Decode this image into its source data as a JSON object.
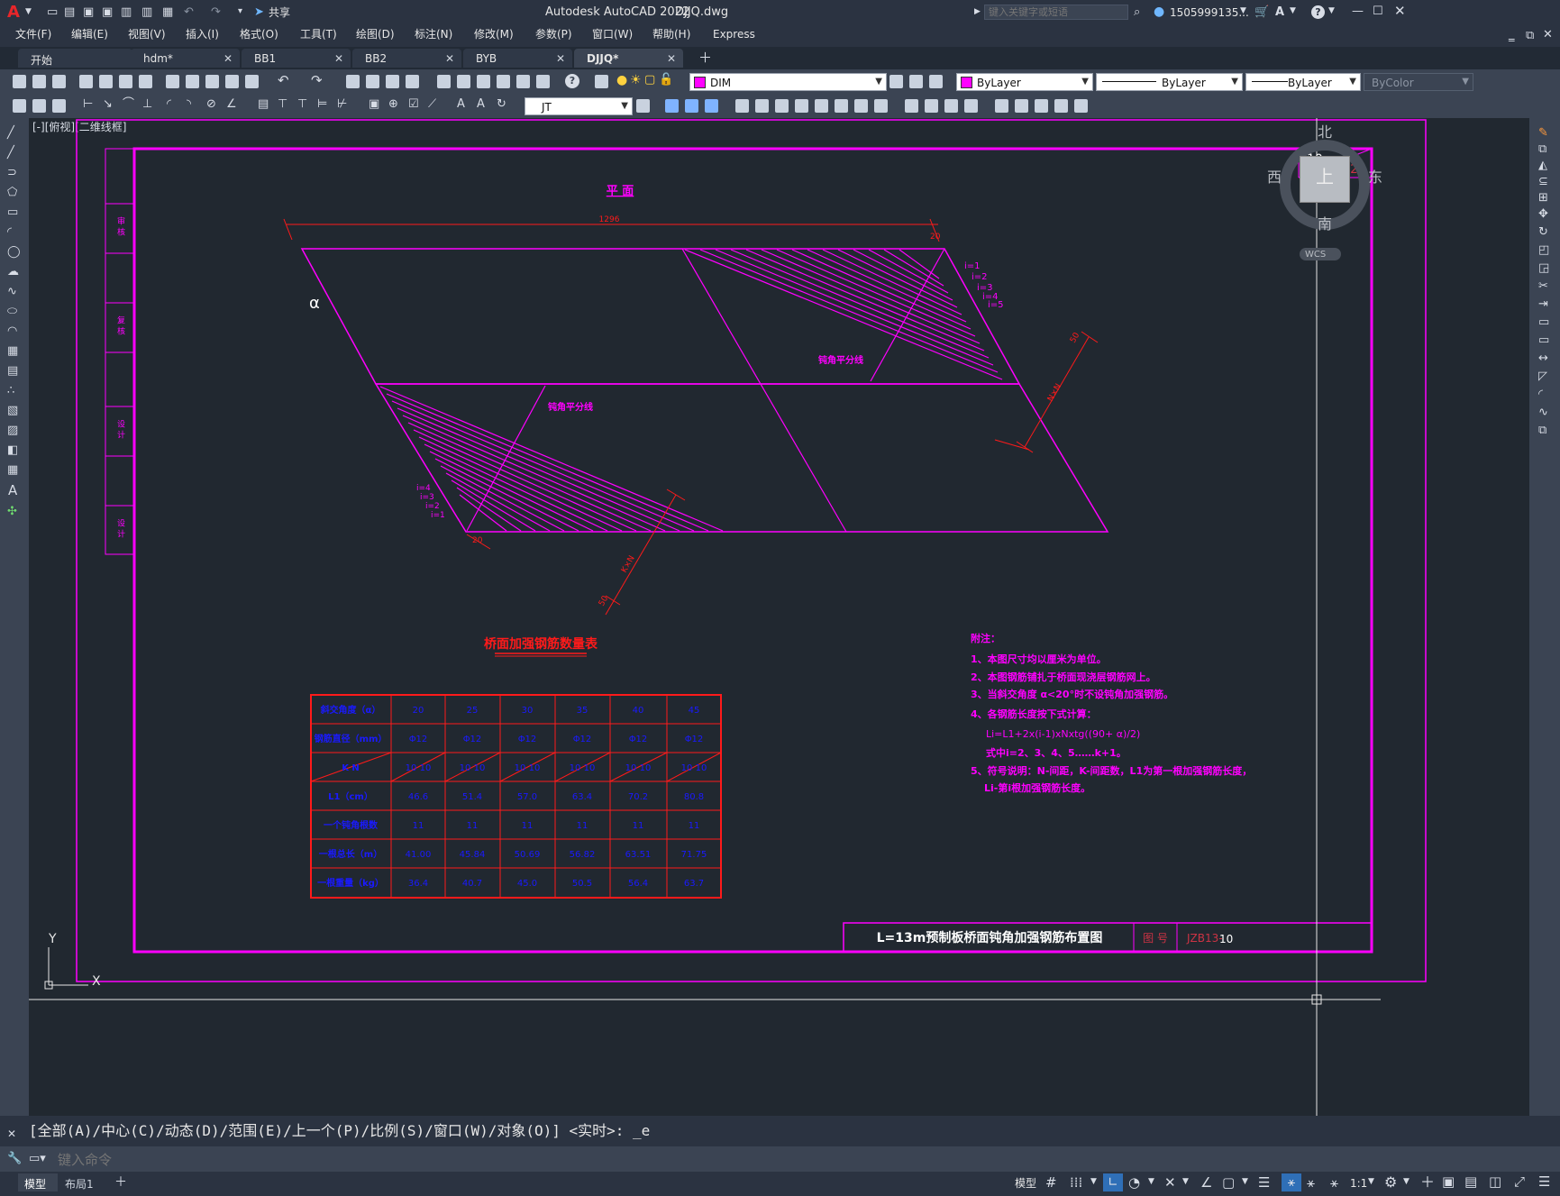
{
  "app": {
    "title": "Autodesk AutoCAD 2022",
    "filename": "DJJQ.dwg",
    "search_placeholder": "键入关键字或短语",
    "user": "1505999135...",
    "share_label": "共享",
    "logo": "A"
  },
  "menu": [
    "文件(F)",
    "编辑(E)",
    "视图(V)",
    "插入(I)",
    "格式(O)",
    "工具(T)",
    "绘图(D)",
    "标注(N)",
    "修改(M)",
    "参数(P)",
    "窗口(W)",
    "帮助(H)",
    "Express"
  ],
  "tabs": [
    {
      "label": "开始",
      "active": false,
      "closable": false
    },
    {
      "label": "hdm*",
      "active": false,
      "closable": true
    },
    {
      "label": "BB1",
      "active": false,
      "closable": true
    },
    {
      "label": "BB2",
      "active": false,
      "closable": true
    },
    {
      "label": "BYB",
      "active": false,
      "closable": true
    },
    {
      "label": "DJJQ*",
      "active": true,
      "closable": true
    }
  ],
  "toolbar": {
    "layer": "DIM",
    "color": "ByLayer",
    "linetype": "ByLayer",
    "lineweight": "ByLayer",
    "plotstyle": "ByColor",
    "textstyle": "JT",
    "layer_color": "#ff00ff"
  },
  "viewport_label": "[-][俯视][二维线框]",
  "viewcube": {
    "north": "北",
    "south": "南",
    "east": "东",
    "west": "西",
    "top": "上",
    "wcs": "WCS"
  },
  "ucs": {
    "y": "Y",
    "x": "X"
  },
  "drawing": {
    "plan_title": "平  面",
    "dim_1296": "1296",
    "dim_20": "20",
    "dim_50": "50",
    "dim_kn": "K×N",
    "dim_nn": "N×N",
    "alpha": "α",
    "bisector_label": "钝角平分线",
    "i_labels": [
      "i=1",
      "i=2",
      "i=3",
      "i=4",
      "i=5"
    ],
    "page_no": "10",
    "page_total": "12",
    "sidebar_labels": [
      "审  核",
      "复  核",
      "设  计",
      "设  计"
    ],
    "table_title": "桥面加强钢筋数量表",
    "table": {
      "rows": [
        {
          "label": "斜交角度（α）",
          "values": [
            "20",
            "25",
            "30",
            "35",
            "40",
            "45"
          ]
        },
        {
          "label": "钢筋直径（mm）",
          "values": [
            "Φ12",
            "Φ12",
            "Φ12",
            "Φ12",
            "Φ12",
            "Φ12"
          ]
        },
        {
          "label": "K    N",
          "values": [
            "10  10",
            "10  10",
            "10  10",
            "10  10",
            "10  10",
            "10  10"
          ]
        },
        {
          "label": "L1（cm）",
          "values": [
            "46.6",
            "51.4",
            "57.0",
            "63.4",
            "70.2",
            "80.8"
          ]
        },
        {
          "label": "一个钝角根数",
          "values": [
            "11",
            "11",
            "11",
            "11",
            "11",
            "11"
          ]
        },
        {
          "label": "一根总长（m）",
          "values": [
            "41.00",
            "45.84",
            "50.69",
            "56.82",
            "63.51",
            "71.75"
          ]
        },
        {
          "label": "一根重量（kg）",
          "values": [
            "36.4",
            "40.7",
            "45.0",
            "50.5",
            "56.4",
            "63.7"
          ]
        }
      ]
    },
    "notes_title": "附注：",
    "notes": [
      "1、本图尺寸均以厘米为单位。",
      "2、本图钢筋铺扎于桥面现浇层钢筋网上。",
      "3、当斜交角度 α<20°时不设钝角加强钢筋。",
      "4、各钢筋长度按下式计算：",
      "Li=L1+2x(i-1)xNxtg((90+ α)/2)",
      "式中i=2、3、4、5……k+1。",
      "5、符号说明：N-间距，K-间距数，L1为第一根加强钢筋长度，",
      "Li-第i根加强钢筋长度。"
    ],
    "title_block": {
      "name": "L=13m预制板桥面钝角加强钢筋布置图",
      "label": "图 号",
      "code": "JZB13-",
      "no": "10"
    }
  },
  "command": {
    "history": "[全部(A)/中心(C)/动态(D)/范围(E)/上一个(P)/比例(S)/窗口(W)/对象(O)] <实时>: _e",
    "placeholder": "键入命令"
  },
  "layout_tabs": [
    "模型",
    "布局1"
  ],
  "status": {
    "model_label": "模型",
    "scale": "1:1"
  },
  "colors": {
    "magenta": "#ff00ff",
    "red": "#ff1a1a",
    "blue": "#1a1aff"
  }
}
